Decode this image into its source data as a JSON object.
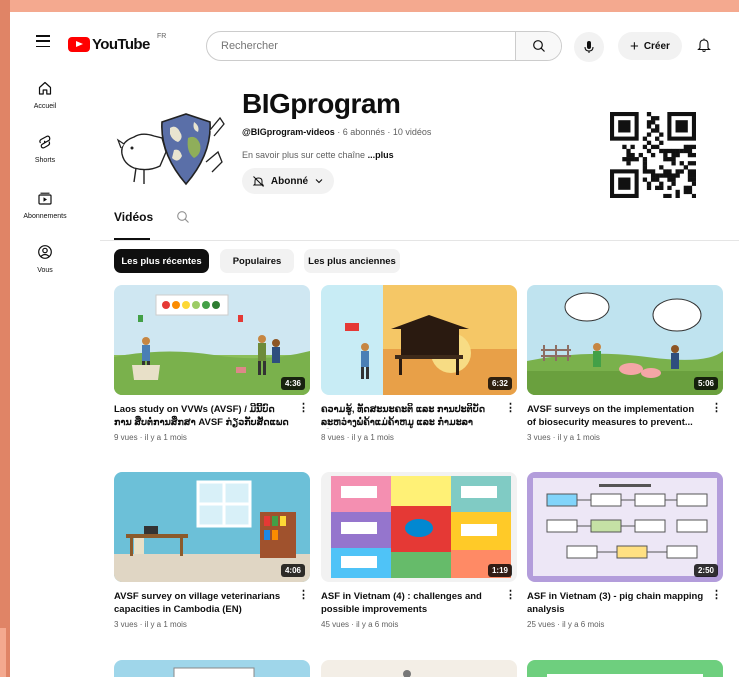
{
  "header": {
    "logo_text": "YouTube",
    "country_code": "FR",
    "search_placeholder": "Rechercher",
    "create_label": "Créer"
  },
  "sidenav": {
    "items": [
      {
        "label": "Accueil",
        "icon": "home-icon"
      },
      {
        "label": "Shorts",
        "icon": "shorts-icon"
      },
      {
        "label": "Abonnements",
        "icon": "subscriptions-icon"
      },
      {
        "label": "Vous",
        "icon": "you-icon"
      }
    ]
  },
  "channel": {
    "name": "BIGprogram",
    "handle": "@BIGprogram-videos",
    "stats": " · 6 abonnés · 10 vidéos",
    "desc_prefix": "En savoir plus sur cette chaîne ",
    "desc_more": "...plus",
    "subscribe_label": "Abonné"
  },
  "tabs": {
    "videos_label": "Vidéos"
  },
  "chips": [
    "Les plus récentes",
    "Populaires",
    "Les plus anciennes"
  ],
  "videos": [
    {
      "title": "Laos study on VVWs (AVSF) / ມີນີ້ບົດການ ສືບຕໍ່ການສຶກສາ AVSF ກ່ຽວກັບສັດແພດບ້ານ...",
      "meta": "9 vues · il y a 1 mois",
      "duration": "4:36"
    },
    {
      "title": "ຄວາມຮູ້, ທັດສະນະຄະຕິ ແລະ ການປະຕິບັດ ລະຫວ່າງພໍ່ຄ້າແມ່ຄ້າຫມູ ແລະ ກຳມະລາ ເພື່ອ...",
      "meta": "8 vues · il y a 1 mois",
      "duration": "6:32"
    },
    {
      "title": "AVSF surveys on the implementation of biosecurity measures to prevent...",
      "meta": "3 vues · il y a 1 mois",
      "duration": "5:06"
    },
    {
      "title": "AVSF survey on village veterinarians capacities in Cambodia (EN)",
      "meta": "3 vues · il y a 1 mois",
      "duration": "4:06"
    },
    {
      "title": "ASF in Vietnam (4) : challenges and possible improvements",
      "meta": "45 vues · il y a 6 mois",
      "duration": "1:19"
    },
    {
      "title": "ASF in Vietnam (3) - pig chain mapping analysis",
      "meta": "25 vues · il y a 6 mois",
      "duration": "2:50"
    }
  ],
  "colors": {
    "background_border": "#f4a98f",
    "brand_red": "#ff0000"
  }
}
